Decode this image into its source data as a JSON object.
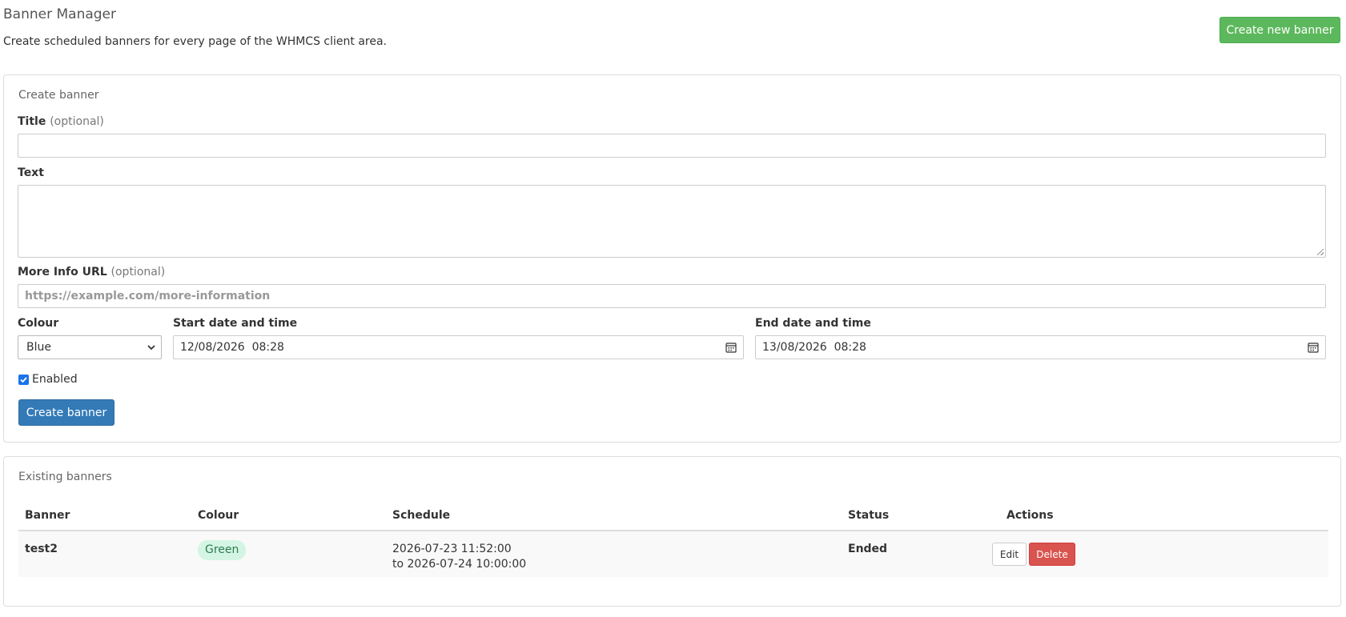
{
  "header": {
    "title": "Banner Manager",
    "description": "Create scheduled banners for every page of the WHMCS client area.",
    "create_new_label": "Create new banner"
  },
  "create_panel": {
    "heading": "Create banner",
    "title_label": "Title",
    "title_optional": "(optional)",
    "title_value": "",
    "text_label": "Text",
    "text_value": "",
    "url_label": "More Info URL",
    "url_optional": "(optional)",
    "url_placeholder": "https://example.com/more-information",
    "colour_label": "Colour",
    "colour_value": "Blue",
    "start_label": "Start date and time",
    "start_value": "12/08/2026  08:28",
    "end_label": "End date and time",
    "end_value": "13/08/2026  08:28",
    "enabled_label": "Enabled",
    "enabled_checked": true,
    "submit_label": "Create banner"
  },
  "existing_panel": {
    "heading": "Existing banners",
    "columns": [
      "Banner",
      "Colour",
      "Schedule",
      "Status",
      "Actions"
    ],
    "rows": [
      {
        "banner": "test2",
        "colour": "Green",
        "schedule_start": "2026-07-23 11:52:00",
        "schedule_end": "to 2026-07-24 10:00:00",
        "status": "Ended",
        "edit_label": "Edit",
        "delete_label": "Delete"
      }
    ]
  },
  "colors": {
    "success": "#5cb85c",
    "primary": "#337ab7",
    "danger": "#d9534f",
    "green_badge_bg": "#d4f5e4"
  },
  "icons": [
    "chevron-down-icon",
    "calendar-icon",
    "checkmark-icon"
  ]
}
